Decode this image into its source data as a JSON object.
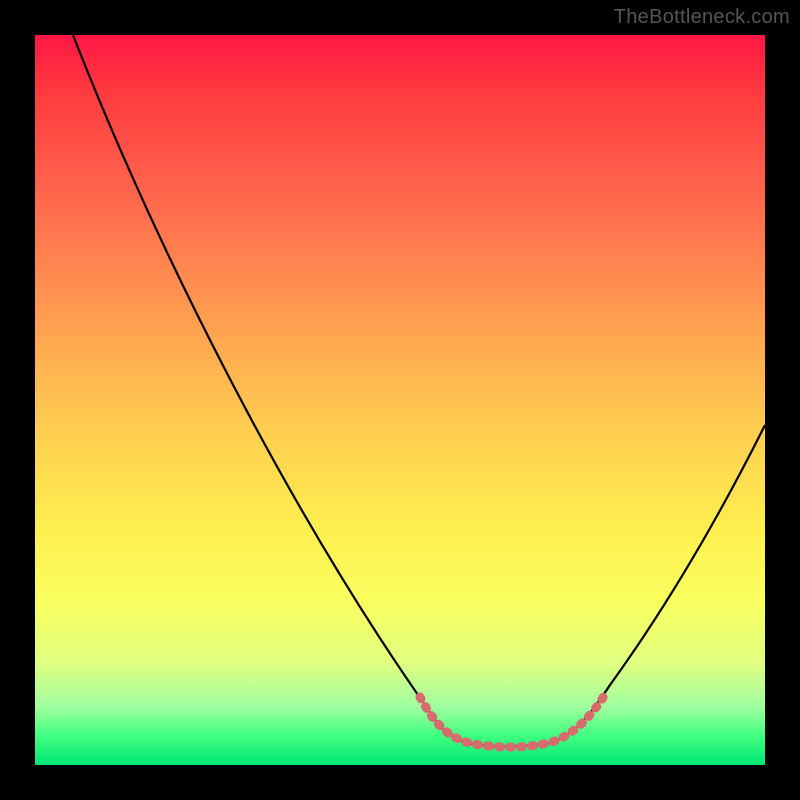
{
  "watermark": "TheBottleneck.com",
  "chart_data": {
    "type": "line",
    "title": "",
    "xlabel": "",
    "ylabel": "",
    "xlim": [
      0,
      100
    ],
    "ylim": [
      0,
      100
    ],
    "grid": false,
    "series": [
      {
        "name": "bottleneck-curve",
        "color": "#000000",
        "x": [
          0,
          10,
          20,
          30,
          40,
          50,
          55,
          60,
          65,
          70,
          75,
          80,
          90,
          100
        ],
        "values": [
          100,
          85,
          70,
          55,
          40,
          25,
          12,
          3,
          2,
          3,
          12,
          25,
          45,
          62
        ]
      },
      {
        "name": "sweet-spot-highlight",
        "color": "#d86b6b",
        "x": [
          54,
          57,
          60,
          63,
          66,
          69,
          72,
          75
        ],
        "values": [
          12,
          6,
          3,
          2,
          2,
          3,
          6,
          12
        ]
      }
    ],
    "annotations": []
  }
}
